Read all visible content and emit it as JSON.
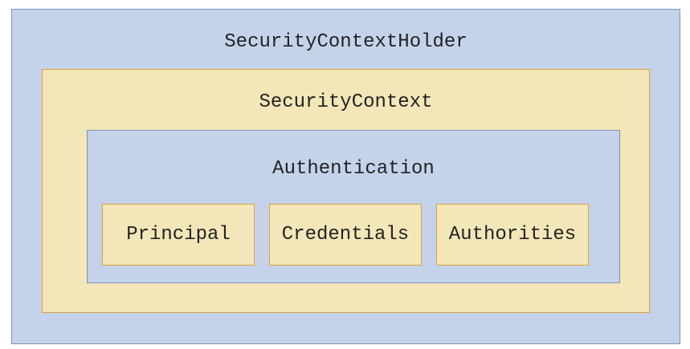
{
  "diagram": {
    "outer": {
      "label": "SecurityContextHolder"
    },
    "middle": {
      "label": "SecurityContext"
    },
    "inner": {
      "label": "Authentication"
    },
    "leaves": [
      {
        "label": "Principal"
      },
      {
        "label": "Credentials"
      },
      {
        "label": "Authorities"
      }
    ]
  },
  "colors": {
    "blue_fill": "#c5d3ea",
    "blue_border": "#7d93bd",
    "yellow_fill": "#f3e6b8",
    "yellow_border": "#d9a441",
    "text": "#222222"
  }
}
